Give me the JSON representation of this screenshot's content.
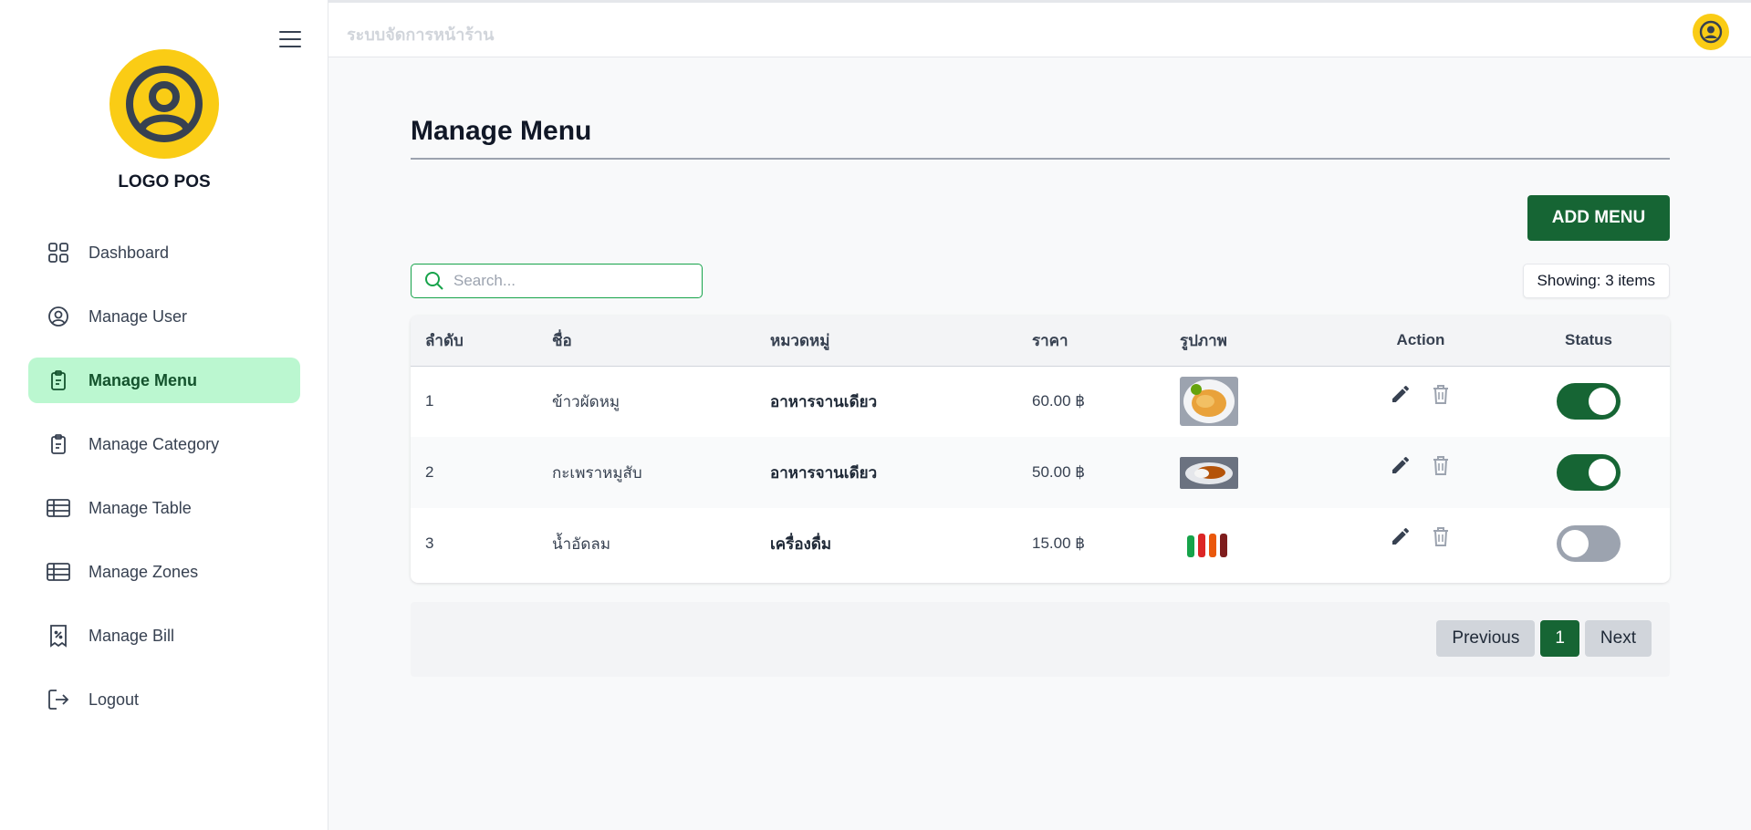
{
  "app": {
    "title": "ระบบจัดการหน้าร้าน",
    "logo_text": "LOGO POS"
  },
  "sidebar": {
    "items": [
      {
        "label": "Dashboard",
        "icon": "grid-icon",
        "active": false
      },
      {
        "label": "Manage User",
        "icon": "user-circle-icon",
        "active": false
      },
      {
        "label": "Manage Menu",
        "icon": "clipboard-icon",
        "active": true
      },
      {
        "label": "Manage Category",
        "icon": "clipboard-icon",
        "active": false
      },
      {
        "label": "Manage Table",
        "icon": "table-icon",
        "active": false
      },
      {
        "label": "Manage Zones",
        "icon": "table-icon",
        "active": false
      },
      {
        "label": "Manage Bill",
        "icon": "receipt-icon",
        "active": false
      },
      {
        "label": "Logout",
        "icon": "logout-icon",
        "active": false
      }
    ]
  },
  "main": {
    "page_title": "Manage Menu",
    "add_button": "ADD MENU",
    "search_placeholder": "Search...",
    "count_text": "Showing: 3 items",
    "table": {
      "columns": [
        "ลำดับ",
        "ชื่อ",
        "หมวดหมู่",
        "ราคา",
        "รูปภาพ",
        "Action",
        "Status"
      ],
      "rows": [
        {
          "no": "1",
          "name": "ข้าวผัดหมู",
          "category": "อาหารจานเดียว",
          "price": "60.00 ฿",
          "image": "fried-rice",
          "status": true
        },
        {
          "no": "2",
          "name": "กะเพราหมูสับ",
          "category": "อาหารจานเดียว",
          "price": "50.00 ฿",
          "image": "basil-pork",
          "status": true
        },
        {
          "no": "3",
          "name": "น้ำอัดลม",
          "category": "เครื่องดื่ม",
          "price": "15.00 ฿",
          "image": "soft-drinks",
          "status": false
        }
      ]
    },
    "pagination": {
      "previous": "Previous",
      "current_page": "1",
      "next": "Next"
    }
  },
  "colors": {
    "accent": "#166534",
    "active_nav": "#bbf7d0",
    "logo": "#facc15"
  }
}
